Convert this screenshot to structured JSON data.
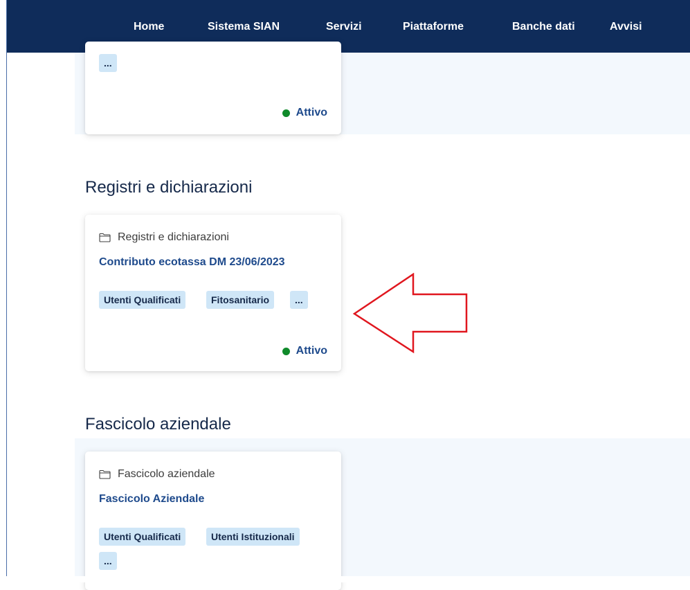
{
  "nav": {
    "items": [
      "Home",
      "Sistema SIAN",
      "Servizi",
      "Piattaforme",
      "Banche dati",
      "Avvisi"
    ],
    "active": "Home"
  },
  "top_card": {
    "tag_more": "...",
    "status": "Attivo"
  },
  "sections": [
    {
      "title": "Registri e dichiarazioni",
      "card": {
        "category": "Registri e dichiarazioni",
        "title": "Contributo ecotassa DM 23/06/2023",
        "tags": [
          "Utenti Qualificati",
          "Fitosanitario",
          "..."
        ],
        "status": "Attivo"
      }
    },
    {
      "title": "Fascicolo aziendale",
      "card": {
        "category": "Fascicolo aziendale",
        "title": "Fascicolo Aziendale",
        "tags": [
          "Utenti Qualificati",
          "Utenti Istituzionali",
          "..."
        ]
      }
    }
  ],
  "icons": {
    "category": "folder-icon",
    "annotation": "red-arrow-left-icon"
  },
  "colors": {
    "nav_bg": "#0f2c5a",
    "title_blue": "#1e4a8c",
    "tag_bg": "#cfe6f7",
    "status_green": "#0f8a2a",
    "annotation_red": "#e0161e"
  }
}
